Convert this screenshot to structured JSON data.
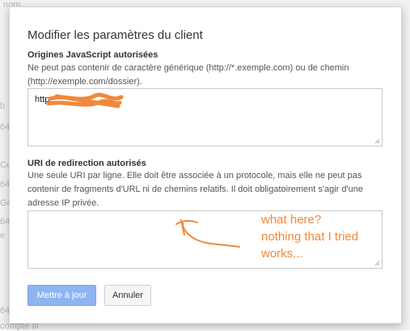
{
  "background": {
    "fragments": [
      "nom",
      "b",
      "64",
      "Ce",
      "64",
      "Ge",
      "64",
      "e",
      "64",
      "compte ai"
    ]
  },
  "dialog": {
    "title": "Modifier les paramètres du client",
    "js_origins": {
      "label": "Origines JavaScript autorisées",
      "help": "Ne peut pas contenir de caractère générique (http://*.exemple.com) ou de chemin (http://exemple.com/dossier).",
      "value": "http:"
    },
    "redirect_uris": {
      "label": "URI de redirection autorisés",
      "help": "Une seule URI par ligne. Elle doit être associée à un protocole, mais elle ne peut pas contenir de fragments d'URL ni de chemins relatifs. Il doit obligatoirement s'agir d'une adresse IP privée.",
      "value": ""
    },
    "buttons": {
      "update": "Mettre à jour",
      "cancel": "Annuler"
    }
  },
  "annotation": {
    "lines": [
      "what here?",
      "nothing that I tried",
      "works..."
    ]
  },
  "colors": {
    "annotation": "#f0883a",
    "primary_button": "#8fb4f2"
  }
}
